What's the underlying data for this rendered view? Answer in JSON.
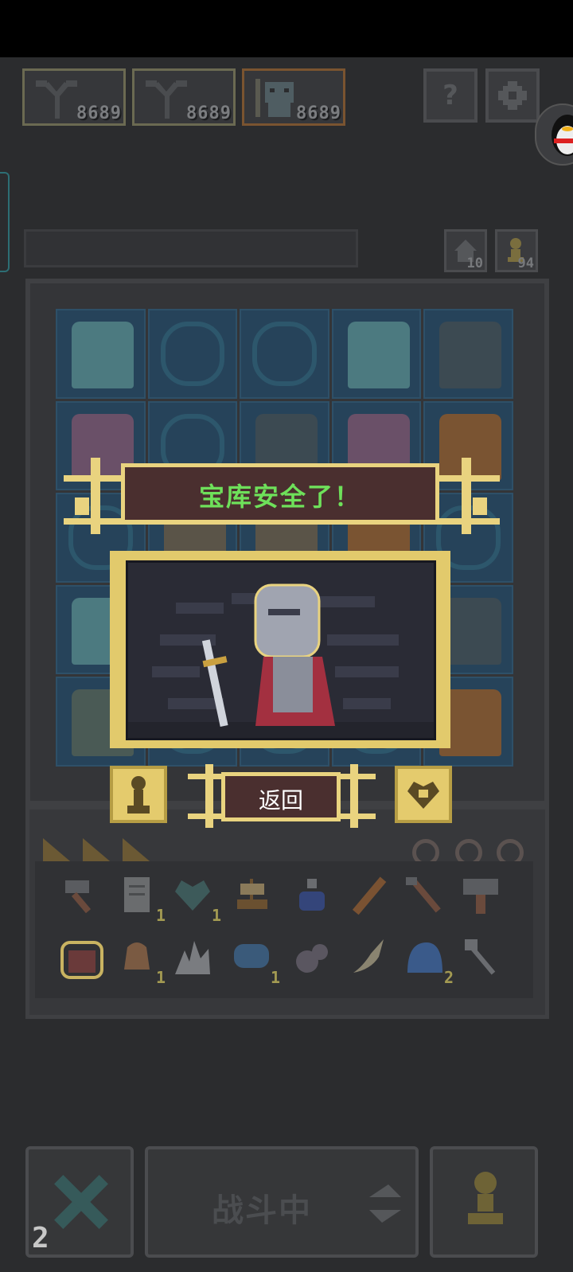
{
  "heroes": [
    {
      "count": "8689",
      "icon": "tree-icon"
    },
    {
      "count": "8689",
      "icon": "tree-icon"
    },
    {
      "count": "8689",
      "icon": "orc-icon"
    }
  ],
  "top_buttons": [
    {
      "label": "?",
      "icon": "help-icon"
    },
    {
      "label": "",
      "icon": "gear-icon"
    }
  ],
  "resources": [
    {
      "value": "10",
      "icon": "house-icon"
    },
    {
      "value": "94",
      "icon": "pawn-icon"
    }
  ],
  "dialog": {
    "title": "宝库安全了！",
    "back_label": "返回",
    "left_icon": "pawn-icon",
    "right_icon": "heart-icon"
  },
  "inventory": {
    "row1": [
      {
        "icon": "hammer-icon",
        "count": ""
      },
      {
        "icon": "scroll-icon",
        "count": "1"
      },
      {
        "icon": "heart-icon",
        "count": "1"
      },
      {
        "icon": "ship-icon",
        "count": ""
      },
      {
        "icon": "potion-icon",
        "count": ""
      },
      {
        "icon": "plank-icon",
        "count": ""
      },
      {
        "icon": "pickaxe-icon",
        "count": ""
      },
      {
        "icon": "warhammer-icon",
        "count": ""
      }
    ],
    "row2": [
      {
        "icon": "bag-icon",
        "count": ""
      },
      {
        "icon": "bell-icon",
        "count": "1"
      },
      {
        "icon": "crystal-icon",
        "count": ""
      },
      {
        "icon": "fish-icon",
        "count": "1"
      },
      {
        "icon": "squirrel-icon",
        "count": ""
      },
      {
        "icon": "feather-icon",
        "count": ""
      },
      {
        "icon": "slime-icon",
        "count": "2"
      },
      {
        "icon": "axe-icon",
        "count": ""
      }
    ]
  },
  "bottom": {
    "battle_label": "战斗中",
    "counter": "2"
  },
  "colors": {
    "background": "#2b2c2e",
    "gold": "#e9d37f",
    "banner": "#4a2f2f",
    "title_green": "#6ee05a"
  }
}
